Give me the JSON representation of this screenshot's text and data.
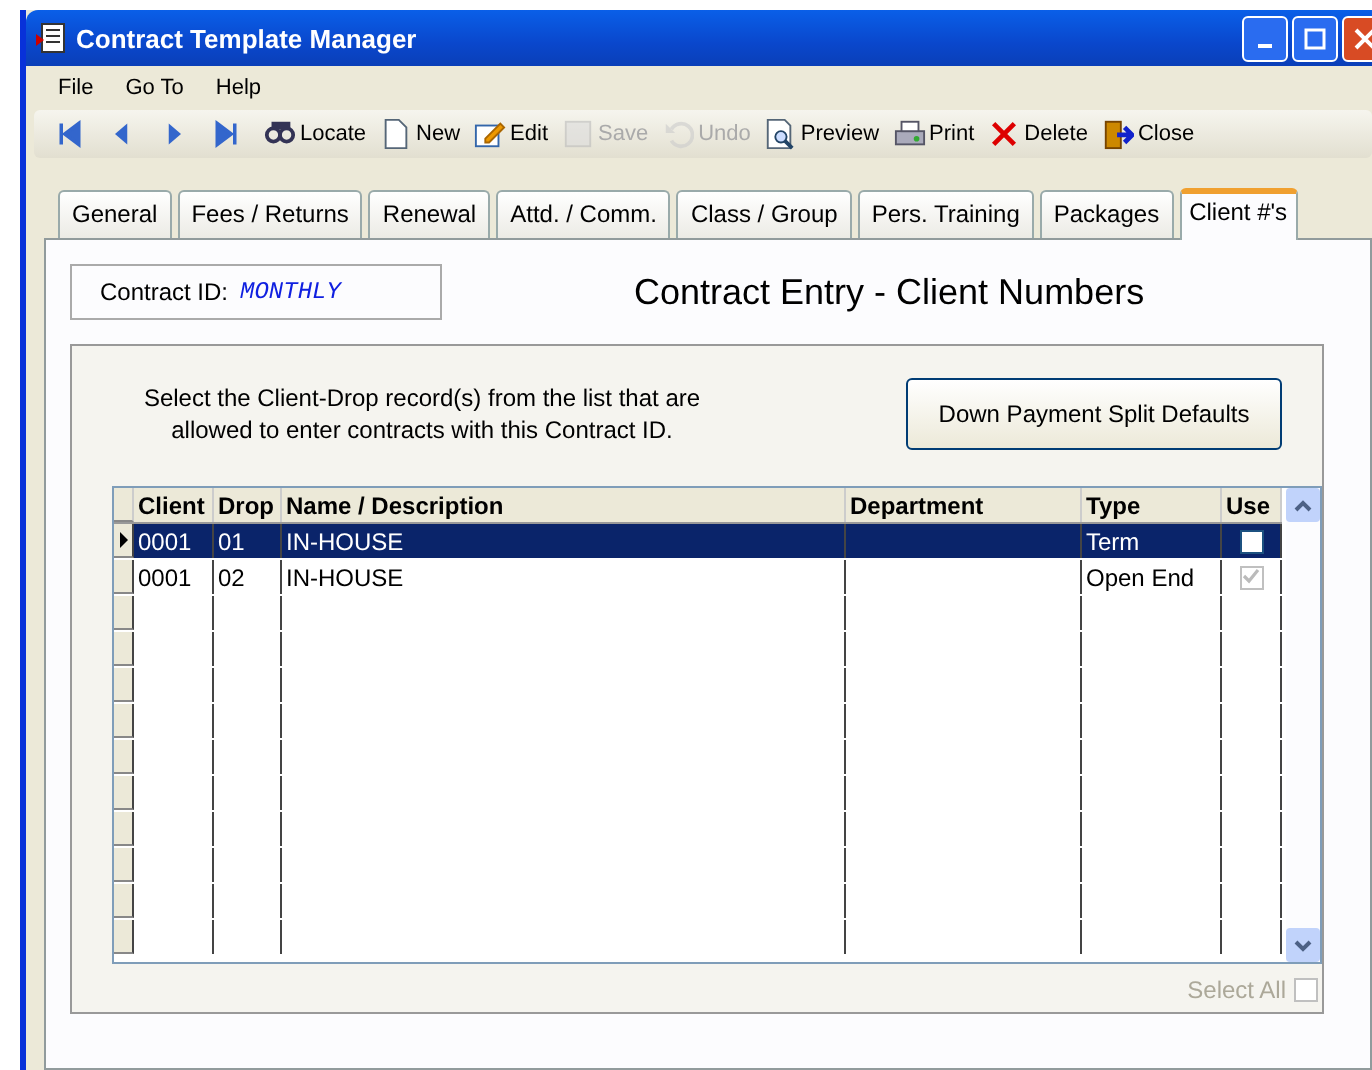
{
  "window": {
    "title": "Contract Template Manager"
  },
  "menu": [
    "File",
    "Go To",
    "Help"
  ],
  "toolbar": [
    {
      "label": "Locate",
      "disabled": false
    },
    {
      "label": "New",
      "disabled": false
    },
    {
      "label": "Edit",
      "disabled": false
    },
    {
      "label": "Save",
      "disabled": true
    },
    {
      "label": "Undo",
      "disabled": true
    },
    {
      "label": "Preview",
      "disabled": false
    },
    {
      "label": "Print",
      "disabled": false
    },
    {
      "label": "Delete",
      "disabled": false
    },
    {
      "label": "Close",
      "disabled": false
    }
  ],
  "tabs": [
    {
      "label": "General",
      "selected": false
    },
    {
      "label": "Fees / Returns",
      "selected": false
    },
    {
      "label": "Renewal",
      "selected": false
    },
    {
      "label": "Attd. / Comm.",
      "selected": false
    },
    {
      "label": "Class / Group",
      "selected": false
    },
    {
      "label": "Pers. Training",
      "selected": false
    },
    {
      "label": "Packages",
      "selected": false
    },
    {
      "label": "Client #'s",
      "selected": true
    }
  ],
  "contract_id": {
    "label": "Contract ID:",
    "value": "MONTHLY"
  },
  "heading": "Contract Entry - Client Numbers",
  "instructions": "Select the Client-Drop record(s) from the list that are allowed to enter contracts with this Contract ID.",
  "split_button": "Down Payment Split Defaults",
  "table": {
    "columns": [
      "Client",
      "Drop",
      "Name / Description",
      "Department",
      "Type",
      "Use"
    ],
    "rows": [
      {
        "client": "0001",
        "drop": "01",
        "name": "IN-HOUSE",
        "type": "Term",
        "use": false,
        "use_disabled": false,
        "selected": true
      },
      {
        "client": "0001",
        "drop": "02",
        "name": "IN-HOUSE",
        "type": "Open End",
        "use": true,
        "use_disabled": true,
        "selected": false
      }
    ]
  },
  "select_all": {
    "label": "Select All",
    "checked": false,
    "disabled": true
  }
}
